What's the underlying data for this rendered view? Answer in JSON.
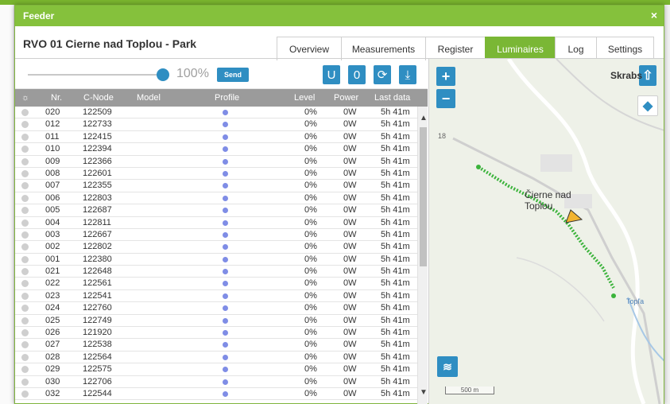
{
  "dialog": {
    "title": "Feeder",
    "close_label": "×"
  },
  "header": {
    "page_title": "RVO 01 Cierne nad Toplou - Park"
  },
  "tabs": [
    "Overview",
    "Measurements",
    "Register",
    "Luminaires",
    "Log",
    "Settings"
  ],
  "active_tab": "Luminaires",
  "controls": {
    "dim_level": 1.0,
    "dim_level_label": "100%",
    "send_label": "Send",
    "buttons": [
      {
        "label": "U",
        "icon": "u-letter"
      },
      {
        "label": "0",
        "icon": "zero"
      },
      {
        "label": "⟳",
        "icon": "refresh-icon"
      },
      {
        "label": "⤓",
        "icon": "download-icon"
      }
    ]
  },
  "table": {
    "headers": [
      "☼",
      "Nr.",
      "C-Node",
      "Model",
      "Profile",
      "Level",
      "Power",
      "Last data"
    ],
    "rows": [
      {
        "nr": "020",
        "cnode": "122509",
        "level": "0%",
        "power": "0W",
        "last": "5h 41m"
      },
      {
        "nr": "012",
        "cnode": "122733",
        "level": "0%",
        "power": "0W",
        "last": "5h 41m"
      },
      {
        "nr": "011",
        "cnode": "122415",
        "level": "0%",
        "power": "0W",
        "last": "5h 41m"
      },
      {
        "nr": "010",
        "cnode": "122394",
        "level": "0%",
        "power": "0W",
        "last": "5h 41m"
      },
      {
        "nr": "009",
        "cnode": "122366",
        "level": "0%",
        "power": "0W",
        "last": "5h 41m"
      },
      {
        "nr": "008",
        "cnode": "122601",
        "level": "0%",
        "power": "0W",
        "last": "5h 41m"
      },
      {
        "nr": "007",
        "cnode": "122355",
        "level": "0%",
        "power": "0W",
        "last": "5h 41m"
      },
      {
        "nr": "006",
        "cnode": "122803",
        "level": "0%",
        "power": "0W",
        "last": "5h 41m"
      },
      {
        "nr": "005",
        "cnode": "122687",
        "level": "0%",
        "power": "0W",
        "last": "5h 41m"
      },
      {
        "nr": "004",
        "cnode": "122811",
        "level": "0%",
        "power": "0W",
        "last": "5h 41m"
      },
      {
        "nr": "003",
        "cnode": "122667",
        "level": "0%",
        "power": "0W",
        "last": "5h 41m"
      },
      {
        "nr": "002",
        "cnode": "122802",
        "level": "0%",
        "power": "0W",
        "last": "5h 41m"
      },
      {
        "nr": "001",
        "cnode": "122380",
        "level": "0%",
        "power": "0W",
        "last": "5h 41m"
      },
      {
        "nr": "021",
        "cnode": "122648",
        "level": "0%",
        "power": "0W",
        "last": "5h 41m"
      },
      {
        "nr": "022",
        "cnode": "122561",
        "level": "0%",
        "power": "0W",
        "last": "5h 41m"
      },
      {
        "nr": "023",
        "cnode": "122541",
        "level": "0%",
        "power": "0W",
        "last": "5h 41m"
      },
      {
        "nr": "024",
        "cnode": "122760",
        "level": "0%",
        "power": "0W",
        "last": "5h 41m"
      },
      {
        "nr": "025",
        "cnode": "122749",
        "level": "0%",
        "power": "0W",
        "last": "5h 41m"
      },
      {
        "nr": "026",
        "cnode": "121920",
        "level": "0%",
        "power": "0W",
        "last": "5h 41m"
      },
      {
        "nr": "027",
        "cnode": "122538",
        "level": "0%",
        "power": "0W",
        "last": "5h 41m"
      },
      {
        "nr": "028",
        "cnode": "122564",
        "level": "0%",
        "power": "0W",
        "last": "5h 41m"
      },
      {
        "nr": "029",
        "cnode": "122575",
        "level": "0%",
        "power": "0W",
        "last": "5h 41m"
      },
      {
        "nr": "030",
        "cnode": "122706",
        "level": "0%",
        "power": "0W",
        "last": "5h 41m"
      },
      {
        "nr": "032",
        "cnode": "122544",
        "level": "0%",
        "power": "0W",
        "last": "5h 41m"
      }
    ]
  },
  "map": {
    "zoom_in_label": "+",
    "zoom_out_label": "−",
    "place_top": "Skrabs",
    "place_main": "Čierne nad\nToplou",
    "road_label": "18",
    "river_label": "Topľa",
    "scale_label": "500 m",
    "colors": {
      "luminaire": "#3bb33b",
      "accent": "#2f8ec2",
      "header_green": "#85c13c"
    }
  }
}
